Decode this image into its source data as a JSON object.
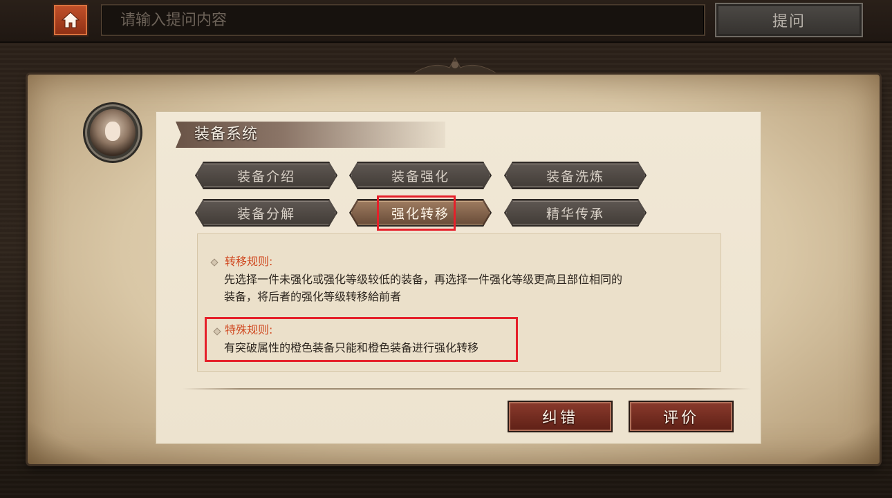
{
  "topbar": {
    "search_placeholder": "请输入提问内容",
    "ask_label": "提问"
  },
  "panel": {
    "title": "装备系统",
    "tabs": [
      {
        "label": "装备介绍",
        "active": false
      },
      {
        "label": "装备强化",
        "active": false
      },
      {
        "label": "装备洗炼",
        "active": false
      },
      {
        "label": "装备分解",
        "active": false
      },
      {
        "label": "强化转移",
        "active": true
      },
      {
        "label": "精华传承",
        "active": false
      }
    ],
    "rules": [
      {
        "heading": "转移规则:",
        "lines": [
          "先选择一件未强化或强化等级较低的装备，再选择一件强化等级更高且部位相同的",
          "装备，将后者的强化等级转移給前者"
        ]
      },
      {
        "heading": "特殊规则:",
        "lines": [
          "有突破属性的橙色装备只能和橙色装备进行强化转移"
        ]
      }
    ],
    "actions": {
      "correct_label": "纠错",
      "rate_label": "评价"
    }
  },
  "colors": {
    "accent_red": "#e5202a",
    "rule_heading": "#d04a22",
    "home_button": "#b2471f"
  }
}
